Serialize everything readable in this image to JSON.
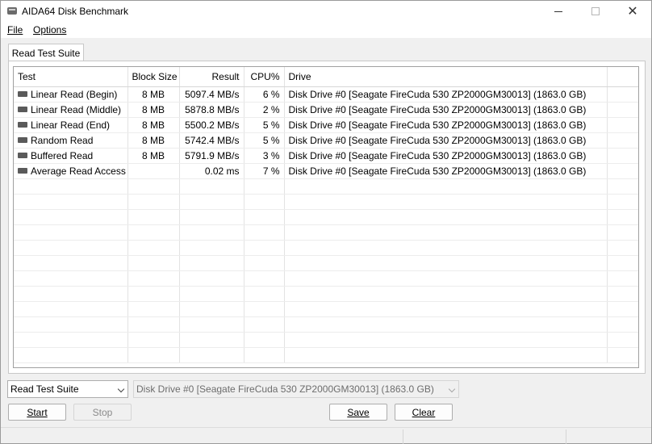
{
  "window": {
    "title": "AIDA64 Disk Benchmark"
  },
  "menu": {
    "file": "File",
    "options": "Options"
  },
  "tab": {
    "label": "Read Test Suite"
  },
  "table": {
    "headers": [
      "Test",
      "Block Size",
      "Result",
      "CPU%",
      "Drive"
    ],
    "rows": [
      [
        "Linear Read (Begin)",
        "8 MB",
        "5097.4 MB/s",
        "6 %",
        "Disk Drive #0  [Seagate FireCuda 530 ZP2000GM30013]  (1863.0 GB)"
      ],
      [
        "Linear Read (Middle)",
        "8 MB",
        "5878.8 MB/s",
        "2 %",
        "Disk Drive #0  [Seagate FireCuda 530 ZP2000GM30013]  (1863.0 GB)"
      ],
      [
        "Linear Read (End)",
        "8 MB",
        "5500.2 MB/s",
        "5 %",
        "Disk Drive #0  [Seagate FireCuda 530 ZP2000GM30013]  (1863.0 GB)"
      ],
      [
        "Random Read",
        "8 MB",
        "5742.4 MB/s",
        "5 %",
        "Disk Drive #0  [Seagate FireCuda 530 ZP2000GM30013]  (1863.0 GB)"
      ],
      [
        "Buffered Read",
        "8 MB",
        "5791.9 MB/s",
        "3 %",
        "Disk Drive #0  [Seagate FireCuda 530 ZP2000GM30013]  (1863.0 GB)"
      ],
      [
        "Average Read Access",
        "",
        "0.02 ms",
        "7 %",
        "Disk Drive #0  [Seagate FireCuda 530 ZP2000GM30013]  (1863.0 GB)"
      ]
    ]
  },
  "controls": {
    "suite_select": "Read Test Suite",
    "drive_select": "Disk Drive #0  [Seagate FireCuda 530 ZP2000GM30013]  (1863.0 GB)",
    "start": "Start",
    "stop": "Stop",
    "save": "Save",
    "clear": "Clear"
  }
}
